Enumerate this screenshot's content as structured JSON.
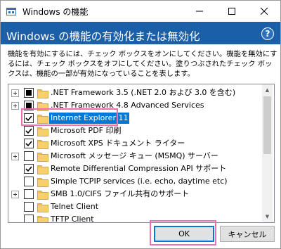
{
  "window": {
    "title": "Windows の機能",
    "minimize_icon": "minimize-icon",
    "maximize_icon": "maximize-icon",
    "close_icon": "close-icon"
  },
  "header": {
    "title": "Windows の機能の有効化または無効化",
    "help_label": "?"
  },
  "description": "機能を有効にするには、チェック ボックスをオンにしてください。機能を無効にするには、チェック ボックスをオフにしてください。塗りつぶされたチェック ボックスは、機能の一部が有効になっていることを表します。",
  "features": [
    {
      "label": ".NET Framework 3.5 (.NET 2.0 および 3.0 を含む)",
      "state": "partial",
      "expandable": true,
      "selected": false
    },
    {
      "label": ".NET Framework 4.8 Advanced Services",
      "state": "partial",
      "expandable": true,
      "selected": false
    },
    {
      "label": "Internet Explorer 11",
      "state": "checked",
      "expandable": false,
      "selected": true
    },
    {
      "label": "Microsoft PDF 印刷",
      "state": "checked",
      "expandable": false,
      "selected": false
    },
    {
      "label": "Microsoft XPS ドキュメント ライター",
      "state": "checked",
      "expandable": false,
      "selected": false
    },
    {
      "label": "Microsoft メッセージ キュー (MSMQ) サーバー",
      "state": "unchecked",
      "expandable": true,
      "selected": false
    },
    {
      "label": "Remote Differential Compression API サポート",
      "state": "checked",
      "expandable": false,
      "selected": false
    },
    {
      "label": "Simple TCPIP services (i.e. echo, daytime etc)",
      "state": "unchecked",
      "expandable": false,
      "selected": false
    },
    {
      "label": "SMB 1.0/CIFS ファイル共有のサポート",
      "state": "unchecked",
      "expandable": true,
      "selected": false
    },
    {
      "label": "Telnet Client",
      "state": "unchecked",
      "expandable": false,
      "selected": false
    },
    {
      "label": "TFTP Client",
      "state": "unchecked",
      "expandable": false,
      "selected": false
    }
  ],
  "buttons": {
    "ok_label": "OK",
    "cancel_label": "キャンセル"
  },
  "colors": {
    "header_band": "#1a5fa8",
    "selection": "#0078d7",
    "annotation": "#f06fb4",
    "folder": "#f5d06b"
  }
}
